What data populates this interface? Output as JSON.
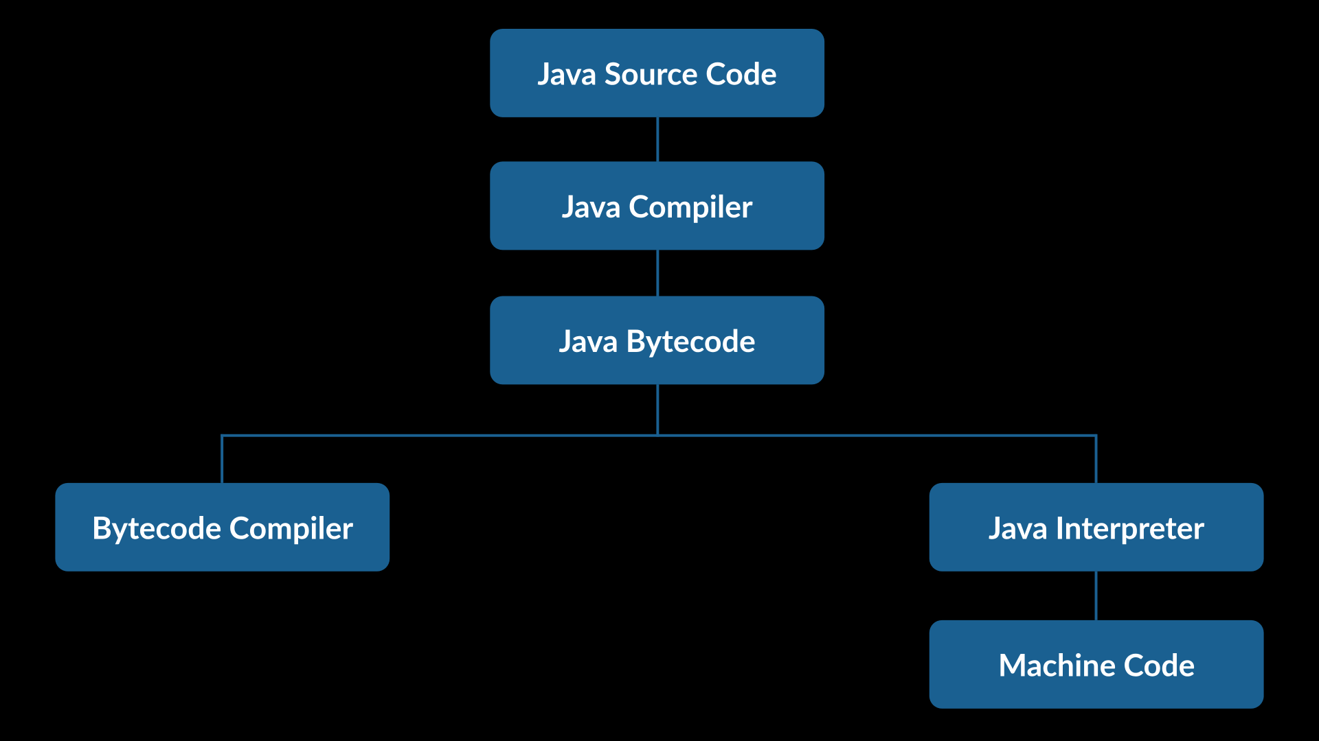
{
  "diagram": {
    "nodes": {
      "source": "Java Source Code",
      "compiler": "Java Compiler",
      "bytecode": "Java Bytecode",
      "bytecode_compiler": "Bytecode Compiler",
      "interpreter": "Java Interpreter",
      "machine": "Machine Code"
    },
    "colors": {
      "node_bg": "#1a6091",
      "node_text": "#ffffff",
      "connector": "#1a6091",
      "page_bg": "#000000"
    },
    "edges": [
      [
        "source",
        "compiler"
      ],
      [
        "compiler",
        "bytecode"
      ],
      [
        "bytecode",
        "bytecode_compiler"
      ],
      [
        "bytecode",
        "interpreter"
      ],
      [
        "interpreter",
        "machine"
      ]
    ]
  }
}
